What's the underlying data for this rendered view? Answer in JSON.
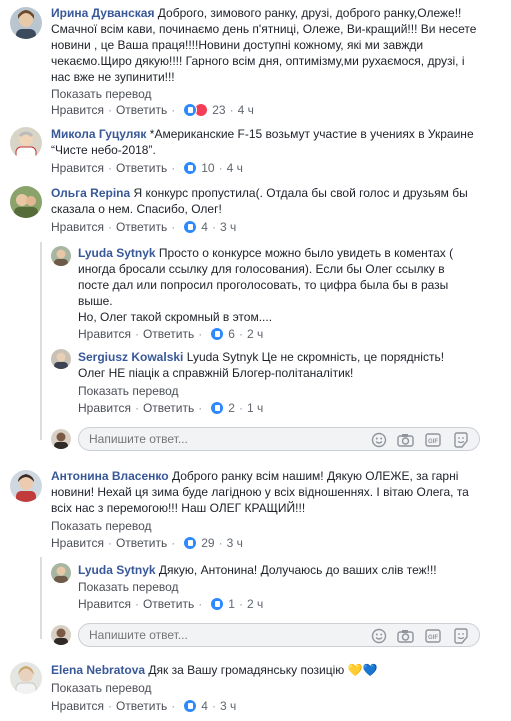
{
  "labels": {
    "like": "Нравится",
    "reply": "Ответить",
    "translation": "Показать перевод",
    "reply_placeholder": "Напишите ответ..."
  },
  "comments": [
    {
      "name": "Ирина Дуванская",
      "lines": [
        "Доброго, зимового ранку, друзі, доброго ранку,Олеже!!",
        "Смачної всім кави, починаємо день п'ятниці, Олеже, Ви-кращий!!! Ви несете",
        "новини , це Ваша праця!!!!Новини доступні кожному, які ми завжди",
        "чекаємо.Щиро дякую!!!! Гарного всім дня, оптимізму,ми рухаємося, друзі, і",
        "нас вже не зупинити!!!"
      ],
      "reactions": "23",
      "time": "4 ч"
    },
    {
      "name": "Микола Гуцуляк",
      "lines": [
        "*Американские F-15 возьмут участие в учениях в Украине",
        "“Чисте небо-2018”."
      ],
      "reactions": "10",
      "time": "4 ч"
    },
    {
      "name": "Ольга Repina",
      "lines": [
        "Я конкурс пропустила(. Отдала бы свой голос и друзьям бы",
        "сказала о нем. Спасибо, Олег!"
      ],
      "reactions": "4",
      "time": "3 ч"
    },
    {
      "name": "Lyuda Sytnyk",
      "lines": [
        "Просто о конкурсе можно было увидеть в коментах (",
        "иногда бросали ссылку для голосования). Если бы Олег ссылку в",
        "посте дал или попросил проголосовать, то цифра была бы в разы",
        "выше.",
        "Но, Олег такой скромный в этом...."
      ],
      "reactions": "6",
      "time": "2 ч"
    },
    {
      "name": "Sergiusz Kowalski",
      "lines": [
        "Lyuda Sytnyk Це не скромність, це порядність!",
        "Олег НЕ піацік а справжній Блогер-політаналітик!"
      ],
      "reactions": "2",
      "time": "1 ч"
    },
    {
      "name": "Антонина Власенко",
      "lines": [
        "Доброго ранку всім нашим! Дякую ОЛЕЖЕ, за гарні",
        "новини! Нехай ця зима буде лагідною у всіх відношеннях. І вітаю Олега, та",
        "всіх нас з перемогою!!! Наш ОЛЕГ КРАЩИЙ!!!"
      ],
      "reactions": "29",
      "time": "3 ч"
    },
    {
      "name": "Lyuda Sytnyk",
      "lines": [
        "Дякую, Антонина! Долучаюсь до ваших слів теж!!!"
      ],
      "reactions": "1",
      "time": "2 ч"
    },
    {
      "name": "Elena Nebratova",
      "lines": [
        "Дяк за Вашу громадянську позицію 💛💙"
      ],
      "reactions": "4",
      "time": "3 ч"
    }
  ],
  "colors": {
    "link": "#385898",
    "meta": "#606770",
    "like_blue": "#2e89ff",
    "love_red": "#f33e58"
  },
  "icons": [
    "like-icon",
    "love-icon",
    "smile-icon",
    "camera-icon",
    "gif-icon",
    "sticker-icon"
  ]
}
